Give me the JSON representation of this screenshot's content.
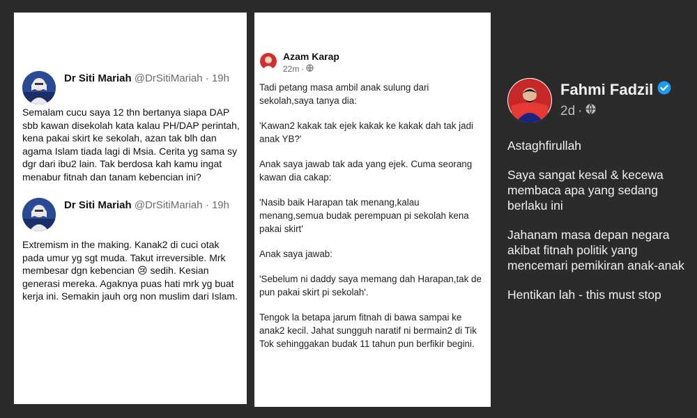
{
  "panel_left": {
    "tweets": [
      {
        "name": "Dr Siti Mariah",
        "handle": "@DrSitiMariah",
        "time": "19h",
        "text": "Semalam cucu saya 12 thn bertanya siapa DAP sbb kawan disekolah kata kalau PH/DAP perintah, kena pakai skirt ke sekolah, azan tak blh dan agama Islam tiada lagi di Msia. Cerita yg sama sy dgr dari ibu2 lain. Tak berdosa kah kamu ingat menabur fitnah dan tanam kebencian ini?"
      },
      {
        "name": "Dr Siti Mariah",
        "handle": "@DrSitiMariah",
        "time": "19h",
        "text": "Extremism in the making. Kanak2 di cuci otak pada umur yg sgt muda. Takut irreversible. Mrk membesar dgn kebencian 😢 sedih. Kesian generasi mereka. Agaknya puas hati mrk yg buat kerja ini. Semakin jauh org non muslim dari Islam."
      }
    ]
  },
  "panel_middle": {
    "name": "Azam Karap",
    "time": "22m",
    "privacy_icon": "globe-icon",
    "paragraphs": [
      "Tadi petang masa ambil anak sulung dari sekolah,saya tanya dia:",
      "'Kawan2 kakak tak ejek kakak ke kakak dah tak jadi anak YB?'",
      "Anak saya jawab tak ada yang ejek. Cuma seorang kawan dia cakap:",
      "'Nasib baik Harapan tak menang,kalau menang,semua budak perempuan pi sekolah kena pakai skirt'",
      "Anak saya jawab:",
      "'Sebelum ni daddy saya memang dah Harapan,tak de pun pakai skirt pi sekolah'.",
      "Tengok la betapa jarum fitnah di bawa sampai ke anak2 kecil. Jahat sungguh naratif ni bermain2 di Tik Tok sehinggakan budak 11 tahun pun berfikir begini."
    ]
  },
  "panel_right": {
    "name": "Fahmi Fadzil",
    "verified_icon": "verified-badge-icon",
    "time": "2d",
    "privacy_icon": "globe-icon",
    "paragraphs": [
      "Astaghfirullah",
      "Saya sangat kesal & kecewa membaca apa yang sedang berlaku ini",
      "Jahanam masa depan negara akibat fitnah politik yang mencemari pemikiran anak-anak",
      "Hentikan lah - this must stop"
    ]
  },
  "colors": {
    "background": "#2b2b2b",
    "card": "#ffffff",
    "muted_text": "#6b6b6b",
    "verified_blue": "#1d9bf0"
  }
}
